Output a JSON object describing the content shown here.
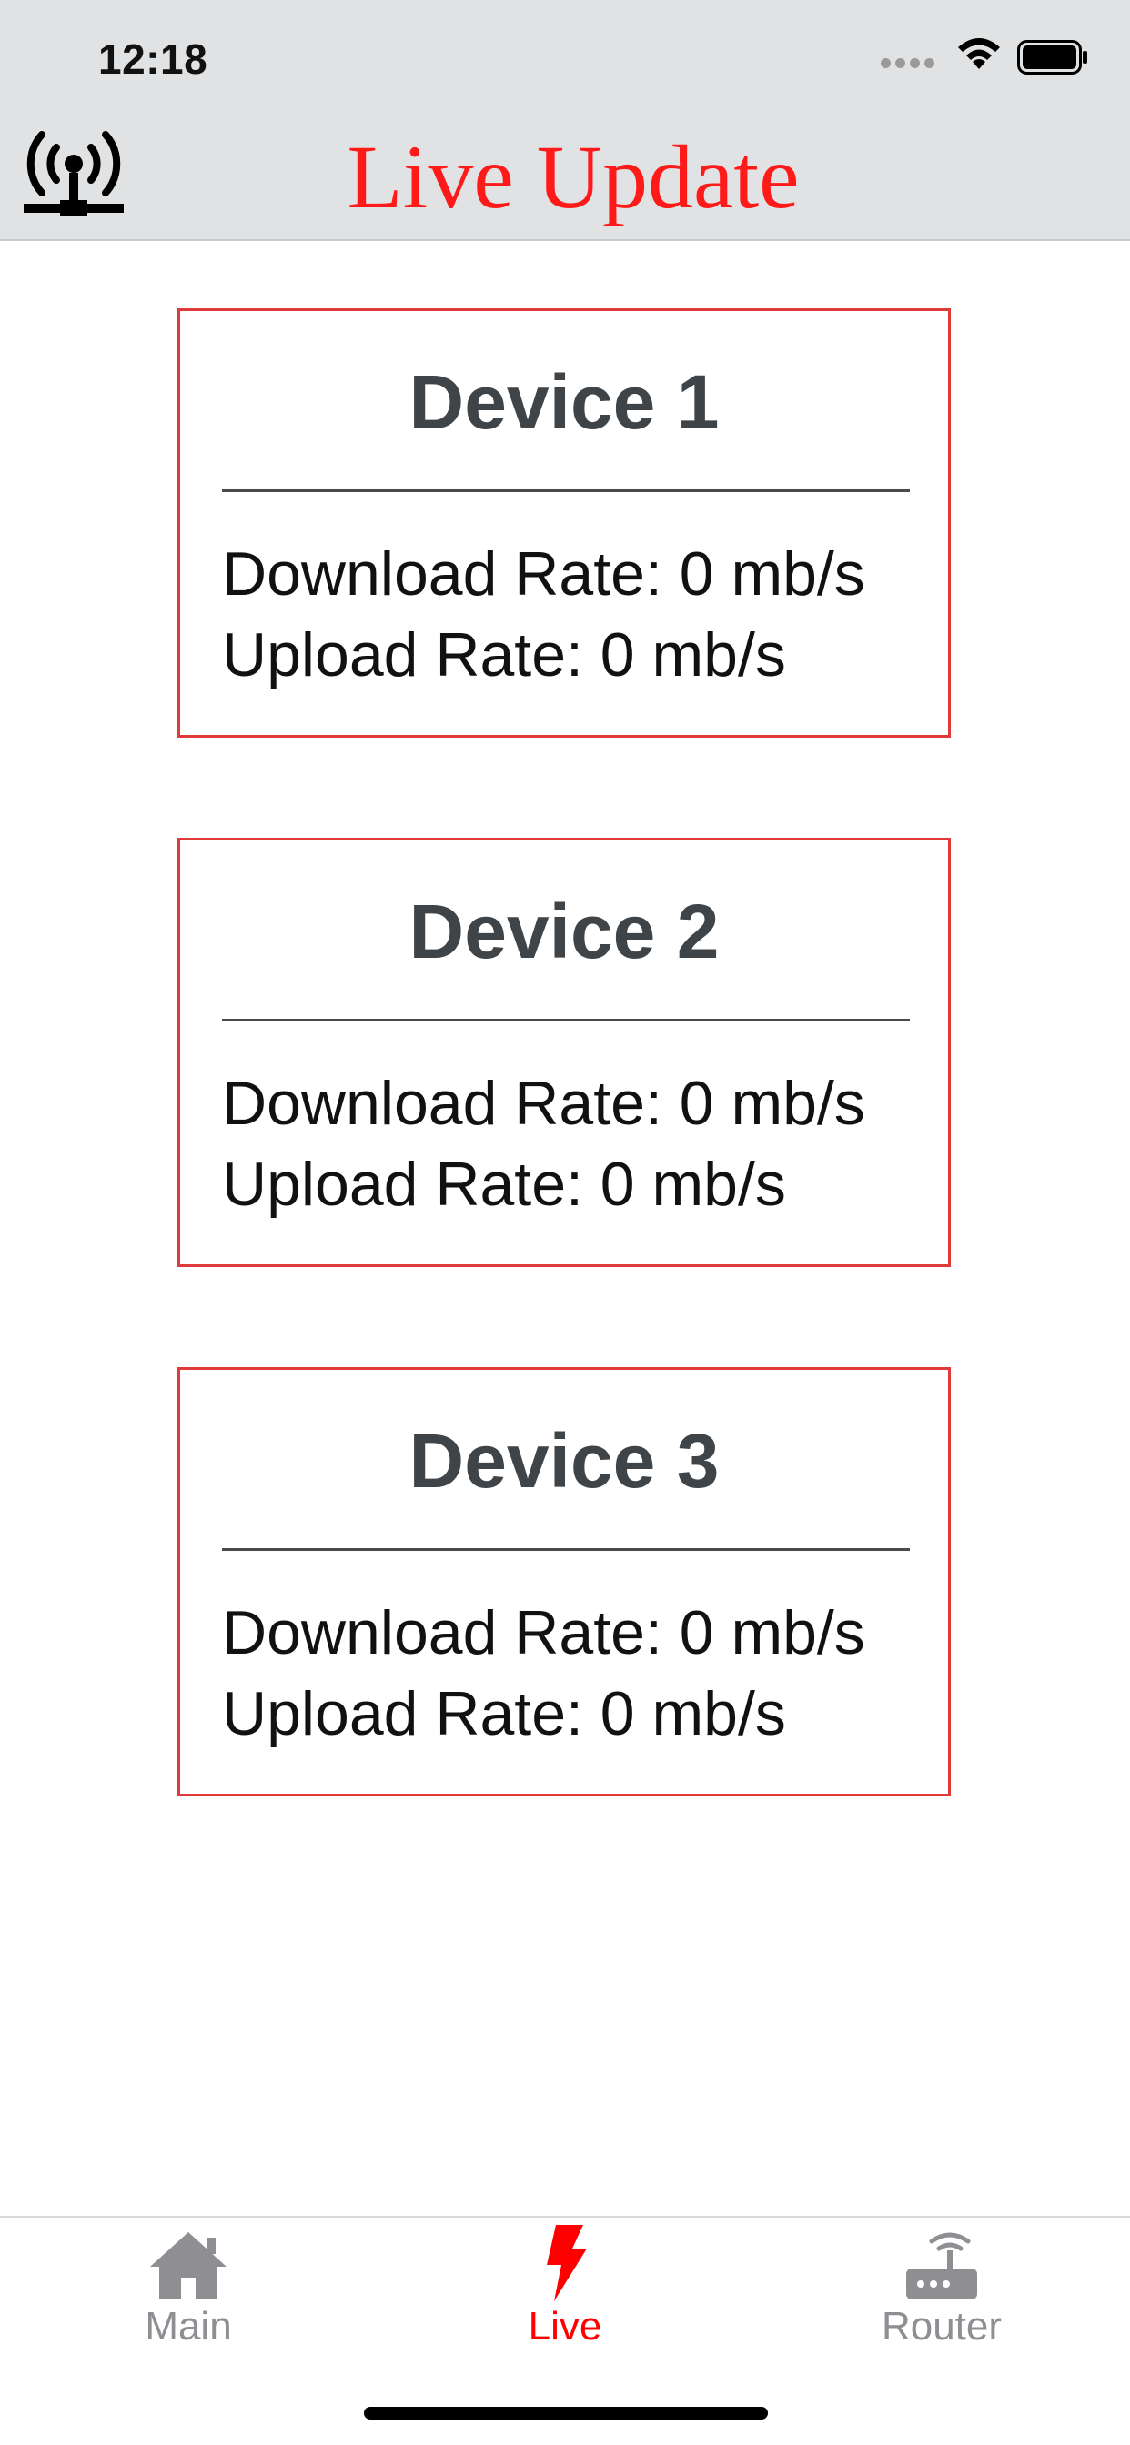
{
  "status_bar": {
    "time": "12:18"
  },
  "nav": {
    "title": "Live Update",
    "title_color": "#ff1a1a",
    "left_icon": "radio-tower-icon"
  },
  "devices": [
    {
      "name": "Device 1",
      "download_text": "Download Rate: 0 mb/s",
      "upload_text": "Upload Rate: 0 mb/s"
    },
    {
      "name": "Device 2",
      "download_text": "Download Rate: 0 mb/s",
      "upload_text": "Upload Rate: 0 mb/s"
    },
    {
      "name": "Device 3",
      "download_text": "Download Rate: 0 mb/s",
      "upload_text": "Upload Rate: 0 mb/s"
    }
  ],
  "tabbar": {
    "tabs": [
      {
        "label": "Main",
        "icon": "home-icon",
        "active": false
      },
      {
        "label": "Live",
        "icon": "lightning-bolt-icon",
        "active": true
      },
      {
        "label": "Router",
        "icon": "router-icon",
        "active": false
      }
    ],
    "active_color": "#ff0000",
    "inactive_color": "#8e8e93"
  },
  "colors": {
    "card_border": "#df3b3b",
    "header_bg": "#e1e2e4"
  }
}
